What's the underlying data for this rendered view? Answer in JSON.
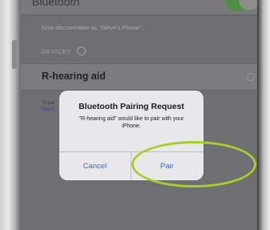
{
  "screen": {
    "top_label": "Bluetooth",
    "discoverable_text": "Now discoverable as \"Steve's Phone\".",
    "devices_header": "DEVICES",
    "device_name": "R-hearing aid",
    "footer_prefix": "To pai",
    "footer_link": "Watch"
  },
  "alert": {
    "title": "Bluetooth Pairing Request",
    "message": "\"R-hearing aid\" would like to pair with your iPhone.",
    "cancel_label": "Cancel",
    "pair_label": "Pair"
  },
  "colors": {
    "toggle_on": "#4f8f43",
    "button_text": "#2f6fd6",
    "highlight_ring": "#a6cf2a",
    "dimmed_overlay": "#6f6f73"
  },
  "icons": {
    "spinner": "activity-spinner-icon",
    "device_status": "loading-icon"
  }
}
